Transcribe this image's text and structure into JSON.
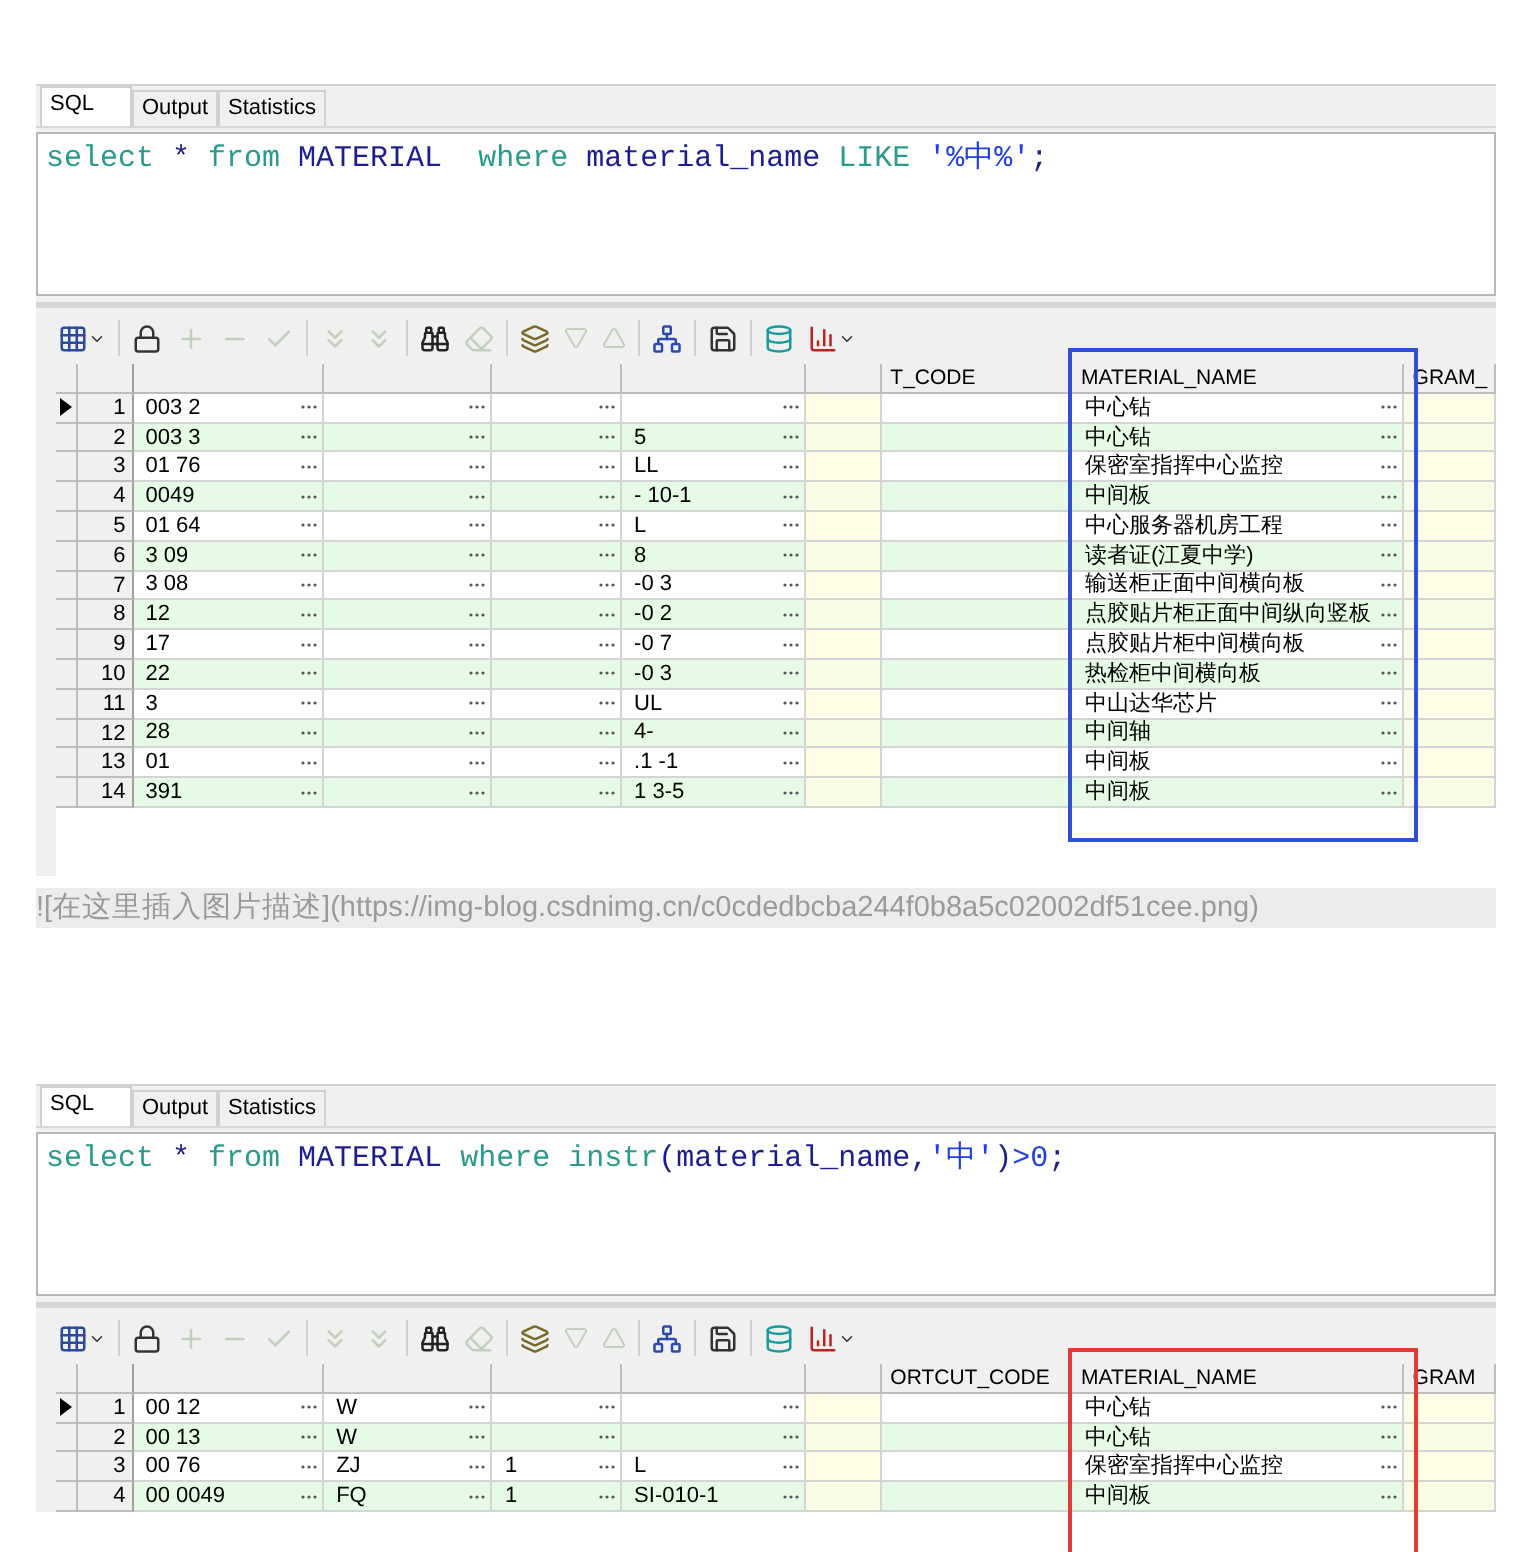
{
  "panels": [
    {
      "tabs": [
        {
          "label": "SQL",
          "selected": true
        },
        {
          "label": "Output",
          "selected": false
        },
        {
          "label": "Statistics",
          "selected": false
        }
      ],
      "sql": [
        {
          "text": "select",
          "kind": "keyword"
        },
        {
          "text": " * ",
          "kind": "ident"
        },
        {
          "text": "from",
          "kind": "keyword"
        },
        {
          "text": " MATERIAL  ",
          "kind": "ident"
        },
        {
          "text": "where",
          "kind": "keyword"
        },
        {
          "text": " material_name ",
          "kind": "ident"
        },
        {
          "text": "LIKE",
          "kind": "keyword"
        },
        {
          "text": " '%中%'",
          "kind": "string"
        },
        {
          "text": ";",
          "kind": "ident"
        }
      ],
      "toolbar": [
        {
          "kind": "grid",
          "disabled": false
        },
        {
          "kind": "lock",
          "disabled": false
        },
        {
          "kind": "plus",
          "disabled": true
        },
        {
          "kind": "minus",
          "disabled": true
        },
        {
          "kind": "check",
          "disabled": true
        },
        {
          "kind": "down",
          "disabled": true
        },
        {
          "kind": "down",
          "disabled": true
        },
        {
          "kind": "find",
          "disabled": false
        },
        {
          "kind": "eraser",
          "disabled": true
        },
        {
          "kind": "export",
          "disabled": false
        },
        {
          "kind": "prev",
          "disabled": true
        },
        {
          "kind": "next",
          "disabled": true
        },
        {
          "kind": "tree",
          "disabled": false
        },
        {
          "kind": "save",
          "disabled": false
        },
        {
          "kind": "db",
          "disabled": false
        },
        {
          "kind": "chart",
          "disabled": false
        }
      ],
      "highlight": {
        "color": "#2f4fd8"
      },
      "columns": [
        {
          "kind": "lookup"
        },
        {
          "kind": "lookup"
        },
        {
          "kind": "lookup"
        },
        {
          "kind": "lookup"
        },
        {
          "kind": "plain"
        },
        {
          "label": "T_CODE",
          "kind": "plain"
        },
        {
          "label": "MATERIAL_NAME",
          "kind": "lookup"
        },
        {
          "label": "GRAM_",
          "kind": "plain"
        }
      ],
      "rows": [
        {
          "number": "1",
          "current": true,
          "cells": [
            "003    2",
            "",
            "",
            "",
            "",
            "",
            "中心钻",
            ""
          ]
        },
        {
          "number": "2",
          "current": false,
          "cells": [
            "003    3",
            "",
            "",
            "5",
            "",
            "",
            "中心钻",
            ""
          ]
        },
        {
          "number": "3",
          "current": false,
          "cells": [
            "01    76",
            "",
            "",
            "LL",
            "",
            "",
            "保密室指挥中心监控",
            ""
          ]
        },
        {
          "number": "4",
          "current": false,
          "cells": [
            "0049",
            "",
            "",
            "-    10-1",
            "",
            "",
            "中间板",
            ""
          ]
        },
        {
          "number": "5",
          "current": false,
          "cells": [
            "01    64",
            "",
            "",
            "L",
            "",
            "",
            "中心服务器机房工程",
            ""
          ]
        },
        {
          "number": "6",
          "current": false,
          "cells": [
            "3    09",
            "",
            "",
            "8",
            "",
            "",
            "读者证(江夏中学)",
            ""
          ]
        },
        {
          "number": "7",
          "current": false,
          "cells": [
            "3    08",
            "",
            "",
            "-0    3",
            "",
            "",
            "输送柜正面中间横向板",
            ""
          ]
        },
        {
          "number": "8",
          "current": false,
          "cells": [
            "12",
            "",
            "",
            "-0    2",
            "",
            "",
            "点胶贴片柜正面中间纵向竖板",
            ""
          ]
        },
        {
          "number": "9",
          "current": false,
          "cells": [
            "17",
            "",
            "",
            "-0    7",
            "",
            "",
            "点胶贴片柜中间横向板",
            ""
          ]
        },
        {
          "number": "10",
          "current": false,
          "cells": [
            "22",
            "",
            "",
            "-0    3",
            "",
            "",
            "热检柜中间横向板",
            ""
          ]
        },
        {
          "number": "11",
          "current": false,
          "cells": [
            "3",
            "",
            "",
            "UL",
            "",
            "",
            "中山达华芯片",
            ""
          ]
        },
        {
          "number": "12",
          "current": false,
          "cells": [
            "28",
            "",
            "",
            "4-",
            "",
            "",
            "中间轴",
            ""
          ]
        },
        {
          "number": "13",
          "current": false,
          "cells": [
            "01",
            "",
            "",
            ".1    -1",
            "",
            "",
            "中间板",
            ""
          ]
        },
        {
          "number": "14",
          "current": false,
          "cells": [
            "391",
            "",
            "",
            "1    3-5",
            "",
            "",
            "中间板",
            ""
          ]
        }
      ]
    },
    {
      "tabs": [
        {
          "label": "SQL",
          "selected": true
        },
        {
          "label": "Output",
          "selected": false
        },
        {
          "label": "Statistics",
          "selected": false
        }
      ],
      "sql": [
        {
          "text": "select",
          "kind": "keyword"
        },
        {
          "text": " * ",
          "kind": "ident"
        },
        {
          "text": "from",
          "kind": "keyword"
        },
        {
          "text": " MATERIAL ",
          "kind": "ident"
        },
        {
          "text": "where",
          "kind": "keyword"
        },
        {
          "text": " instr",
          "kind": "keyword"
        },
        {
          "text": "(material_name,",
          "kind": "ident"
        },
        {
          "text": "'中'",
          "kind": "string"
        },
        {
          "text": ")",
          "kind": "ident"
        },
        {
          "text": ">0",
          "kind": "string"
        },
        {
          "text": ";",
          "kind": "ident"
        }
      ],
      "toolbar": [
        {
          "kind": "grid",
          "disabled": false
        },
        {
          "kind": "lock",
          "disabled": false
        },
        {
          "kind": "plus",
          "disabled": true
        },
        {
          "kind": "minus",
          "disabled": true
        },
        {
          "kind": "check",
          "disabled": true
        },
        {
          "kind": "down",
          "disabled": true
        },
        {
          "kind": "down",
          "disabled": true
        },
        {
          "kind": "find",
          "disabled": false
        },
        {
          "kind": "eraser",
          "disabled": true
        },
        {
          "kind": "export",
          "disabled": false
        },
        {
          "kind": "prev",
          "disabled": true
        },
        {
          "kind": "next",
          "disabled": true
        },
        {
          "kind": "tree",
          "disabled": false
        },
        {
          "kind": "save",
          "disabled": false
        },
        {
          "kind": "db",
          "disabled": false
        },
        {
          "kind": "chart",
          "disabled": false
        }
      ],
      "highlight": {
        "color": "#e53935"
      },
      "columns": [
        {
          "kind": "lookup"
        },
        {
          "kind": "lookup"
        },
        {
          "kind": "lookup"
        },
        {
          "kind": "lookup"
        },
        {
          "kind": "plain"
        },
        {
          "label": "ORTCUT_CODE",
          "kind": "plain"
        },
        {
          "label": "MATERIAL_NAME",
          "kind": "lookup"
        },
        {
          "label": "GRAM",
          "kind": "plain"
        }
      ],
      "rows": [
        {
          "number": "1",
          "current": true,
          "cells": [
            "00    12",
            "W",
            "",
            "",
            "",
            "",
            "中心钻",
            ""
          ]
        },
        {
          "number": "2",
          "current": false,
          "cells": [
            "00    13",
            "W",
            "",
            "",
            "",
            "",
            "中心钻",
            ""
          ]
        },
        {
          "number": "3",
          "current": false,
          "cells": [
            "00    76",
            "ZJ",
            "1",
            "L",
            "",
            "",
            "保密室指挥中心监控",
            ""
          ]
        },
        {
          "number": "4",
          "current": false,
          "cells": [
            "00    0049",
            "FQ",
            "1",
            "SI-010-1",
            "",
            "",
            "中间板",
            ""
          ]
        }
      ]
    }
  ],
  "caption": "![在这里插入图片描述](https://img-blog.csdnimg.cn/c0cdedbcba244f0b8a5c02002df51cee.png)"
}
